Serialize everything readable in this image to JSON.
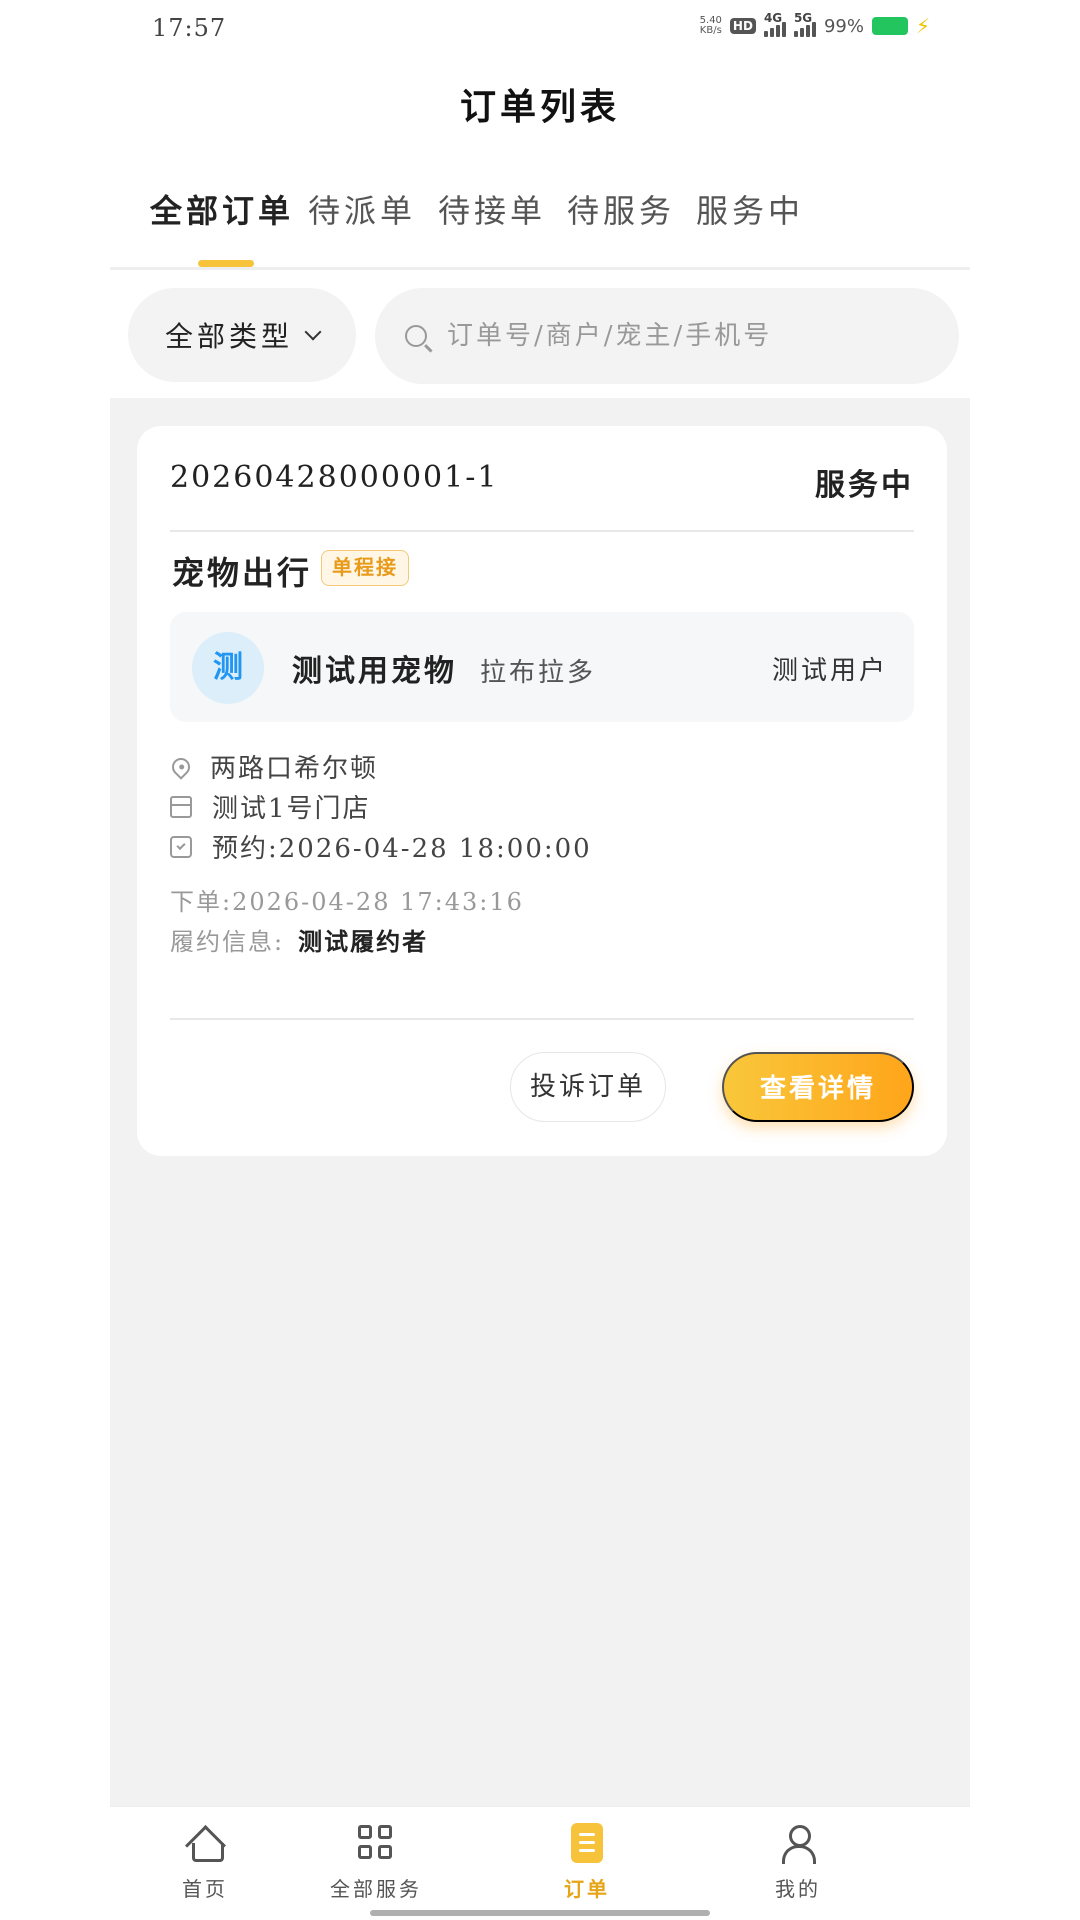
{
  "status_bar": {
    "time": "17:57",
    "net_speed_value": "5.40",
    "net_speed_unit": "KB/s",
    "hd_label": "HD",
    "sim1_label": "4G",
    "sim2_label": "5G",
    "battery_percent": "99%"
  },
  "header": {
    "title": "订单列表"
  },
  "tabs": [
    {
      "label": "全部订单",
      "active": true
    },
    {
      "label": "待派单",
      "active": false
    },
    {
      "label": "待接单",
      "active": false
    },
    {
      "label": "待服务",
      "active": false
    },
    {
      "label": "服务中",
      "active": false
    }
  ],
  "filter": {
    "type_select": "全部类型",
    "search_placeholder": "订单号/商户/宠主/手机号"
  },
  "order": {
    "order_no": "20260428000001-1",
    "status": "服务中",
    "service_name": "宠物出行",
    "trip_tag": "单程接",
    "pet": {
      "avatar_char": "测",
      "name": "测试用宠物",
      "breed": "拉布拉多",
      "owner": "测试用户"
    },
    "address": "两路口希尔顿",
    "store": "测试1号门店",
    "appointment": "预约:2026-04-28 18:00:00",
    "created": "下单:2026-04-28 17:43:16",
    "fulfill_label": "履约信息:",
    "fulfill_value": "测试履约者",
    "complain_button": "投诉订单",
    "detail_button": "查看详情"
  },
  "bottom_nav": [
    {
      "label": "首页",
      "icon": "home-icon",
      "active": false
    },
    {
      "label": "全部服务",
      "icon": "grid-icon",
      "active": false
    },
    {
      "label": "订单",
      "icon": "order-doc-icon",
      "active": true
    },
    {
      "label": "我的",
      "icon": "user-icon",
      "active": false
    }
  ],
  "colors": {
    "accent": "#f6c33a",
    "accent_gradient_end": "#ffa51a",
    "tag_text": "#e89b1a",
    "avatar_text": "#2196f3"
  }
}
